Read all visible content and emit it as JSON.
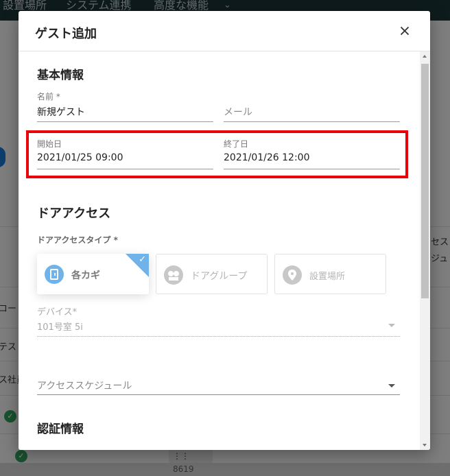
{
  "background": {
    "nav": [
      "設置場所",
      "システム連携",
      "高度な機能"
    ],
    "row_texts": [
      "コード",
      "テス",
      "ス社員"
    ],
    "right_texts": [
      "セス",
      "ジュ"
    ],
    "keypad_value": "8619"
  },
  "dialog": {
    "title": "ゲスト追加",
    "basic_info": {
      "title": "基本情報",
      "name_label": "名前 *",
      "name_value": "新規ゲスト",
      "email_placeholder": "メール",
      "start_label": "開始日",
      "start_value": "2021/01/25 09:00",
      "end_label": "終了日",
      "end_value": "2021/01/26 12:00"
    },
    "door_access": {
      "title": "ドアアクセス",
      "type_label": "ドアアクセスタイプ *",
      "types": [
        {
          "label": "各カギ",
          "icon": "key-door-icon",
          "selected": true
        },
        {
          "label": "ドアグループ",
          "icon": "door-group-icon",
          "selected": false
        },
        {
          "label": "設置場所",
          "icon": "location-pin-icon",
          "selected": false
        }
      ],
      "device_label": "デバイス*",
      "device_value": "101号室 5i",
      "schedule_placeholder": "アクセススケジュール"
    },
    "auth_info": {
      "title": "認証情報"
    }
  },
  "colors": {
    "accent": "#6fb3ea",
    "highlight": "#e8000b",
    "header_dark": "#1b3439"
  }
}
